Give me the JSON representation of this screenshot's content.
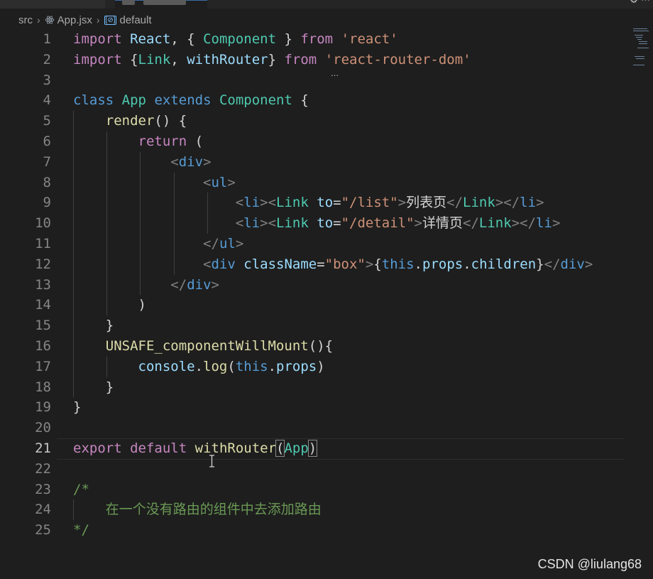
{
  "breadcrumb": {
    "folder": "src",
    "file": "App.jsx",
    "symbol": "default",
    "file_icon": "react-icon",
    "symbol_icon": "symbol-variable-icon"
  },
  "editor": {
    "language": "jsx",
    "active_line": 21,
    "lines": [
      "import React, { Component } from 'react'",
      "import {Link, withRouter} from 'react-router-dom'",
      "",
      "class App extends Component {",
      "    render() {",
      "        return (",
      "            <div>",
      "                <ul>",
      "                    <li><Link to=\"/list\">列表页</Link></li>",
      "                    <li><Link to=\"/detail\">详情页</Link></li>",
      "                </ul>",
      "                <div className=\"box\">{this.props.children}</div>",
      "            </div>",
      "        )",
      "    }",
      "    UNSAFE_componentWillMount(){",
      "        console.log(this.props)",
      "    }",
      "}",
      "",
      "export default withRouter(App)",
      "",
      "/*",
      "    在一个没有路由的组件中去添加路由",
      "*/"
    ]
  },
  "watermark": "CSDN @liulang68",
  "colors": {
    "background": "#1e1e1e",
    "keyword": "#c586c0",
    "storage": "#569cd6",
    "string": "#ce9178",
    "class": "#4ec9b0",
    "function": "#dcdcaa",
    "variable": "#9cdcfe",
    "comment": "#6a9955"
  }
}
